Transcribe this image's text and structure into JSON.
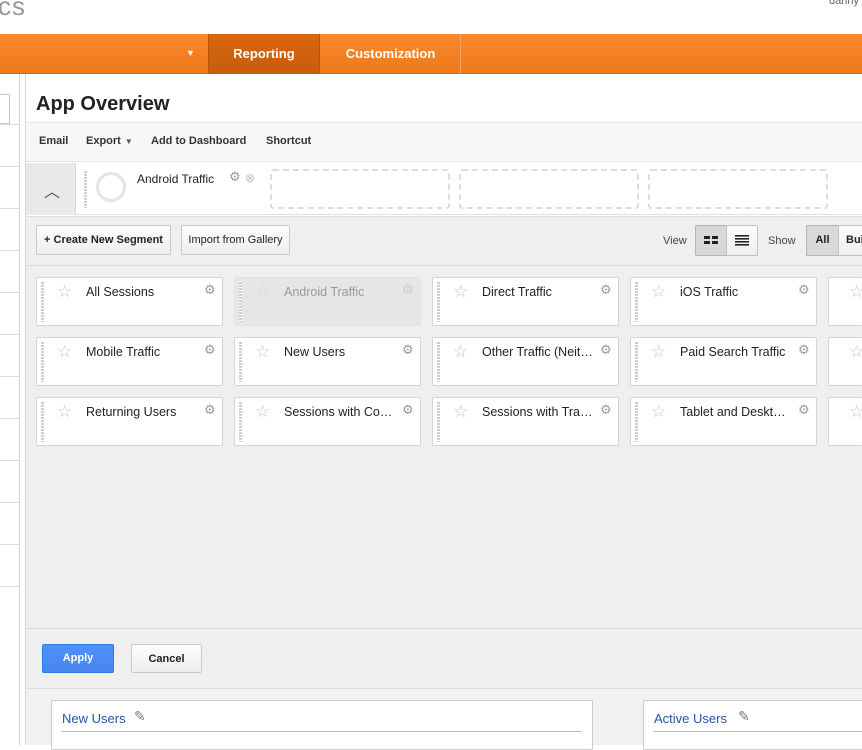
{
  "header": {
    "logo_fragment": "cs",
    "user_fragment": "danny"
  },
  "nav": {
    "dropdown_icon": "caret-down-icon",
    "tabs": [
      {
        "label": "Reporting",
        "active": true
      },
      {
        "label": "Customization",
        "active": false
      }
    ]
  },
  "page": {
    "title": "App Overview"
  },
  "toolbar": {
    "items": [
      "Email",
      "Export",
      "Add to Dashboard",
      "Shortcut"
    ]
  },
  "segment_bar": {
    "collapse_icon": "chevron-up-icon",
    "active_segment": "Android Traffic",
    "empty_slots": 3
  },
  "picker": {
    "create_button": "+ Create New Segment",
    "import_button": "Import from Gallery",
    "view_label": "View",
    "show_label": "Show",
    "show_options": [
      "All",
      "Built-in"
    ],
    "segments": [
      {
        "name": "All Sessions",
        "selected": false
      },
      {
        "name": "Android Traffic",
        "selected": true
      },
      {
        "name": "Direct Traffic",
        "selected": false
      },
      {
        "name": "iOS Traffic",
        "selected": false
      },
      {
        "name": "Mobile Traffic",
        "selected": false
      },
      {
        "name": "New Users",
        "selected": false
      },
      {
        "name": "Other Traffic (Neither Paid nor Organic)",
        "selected": false
      },
      {
        "name": "Paid Search Traffic",
        "selected": false
      },
      {
        "name": "Returning Users",
        "selected": false
      },
      {
        "name": "Sessions with Conversions",
        "selected": false
      },
      {
        "name": "Sessions with Transactions",
        "selected": false
      },
      {
        "name": "Tablet and Desktop Traffic",
        "selected": false
      }
    ],
    "apply_button": "Apply",
    "cancel_button": "Cancel"
  },
  "widgets": [
    {
      "title": "New Users",
      "icon": "edit-icon"
    },
    {
      "title": "Active Users",
      "icon": "edit-icon"
    }
  ],
  "colors": {
    "nav_orange": "#f28426",
    "active_tab": "#cf620c",
    "apply_blue": "#4d90fe",
    "link_blue": "#2256a4"
  }
}
